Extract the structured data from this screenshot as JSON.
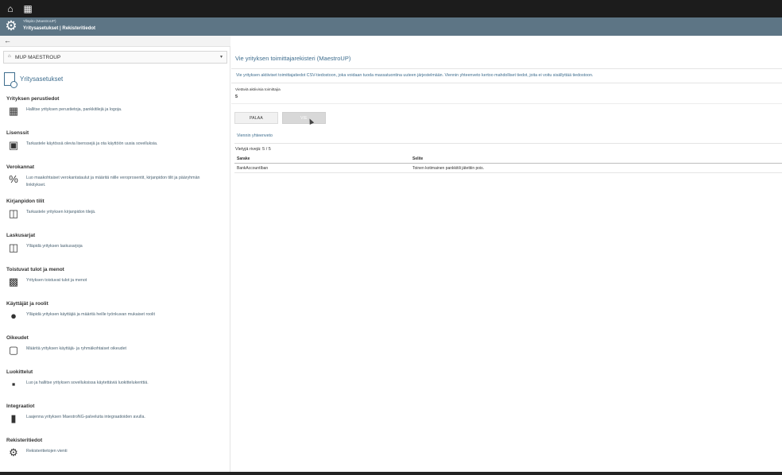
{
  "topbar": {
    "home_icon": "home-icon",
    "apps_icon": "grid-icon"
  },
  "header": {
    "breadcrumb_small": "Ylläpito (MaestroUP)",
    "title": "Yritysasetukset | Rekisteritiedot"
  },
  "sidebar": {
    "company": "MUP MAESTROUP",
    "heading": "Yritysasetukset",
    "items": [
      {
        "title": "Yrityksen perustiedot",
        "desc": "Hallitse yrityksen perustietoja, pankkitilejä ja logoja.",
        "icon": "building-icon"
      },
      {
        "title": "Lisenssit",
        "desc": "Tarkastele käytössä olevia lisenssejä ja ota käyttöön uusia sovelluksia.",
        "icon": "briefcase-icon"
      },
      {
        "title": "Verokannat",
        "desc": "Luo maakohtaiset verokantataulut ja määritä niille veroprosentit, kirjanpidon tilit ja pääryhmän linkitykset.",
        "icon": "percent-icon"
      },
      {
        "title": "Kirjanpidon tilit",
        "desc": "Tarkastele yrityksen kirjanpidon tilejä.",
        "icon": "book-icon"
      },
      {
        "title": "Laskusarjat",
        "desc": "Ylläpidä yrityksen laskusarjoja",
        "icon": "book-icon"
      },
      {
        "title": "Toistuvat tulot ja menot",
        "desc": "Yrityksen toistuvat tulot ja menot",
        "icon": "money-icon"
      },
      {
        "title": "Käyttäjät ja roolit",
        "desc": "Ylläpidä yrityksen käyttäjiä ja määritä heille työnkuvan mukaiset roolit",
        "icon": "user-icon"
      },
      {
        "title": "Oikeudet",
        "desc": "Määritä yrityksen käyttäjä- ja ryhmäkohtaiset oikeudet",
        "icon": "unlock-icon"
      },
      {
        "title": "Luokittelut",
        "desc": "Luo ja hallitse yrityksen sovelluksissa käytettäviä luokittelukenttiä.",
        "icon": "cubes-icon"
      },
      {
        "title": "Integraatiot",
        "desc": "Laajenna yrityksen MaestroNG-palveluita integraatioiden avulla.",
        "icon": "puzzle-icon"
      },
      {
        "title": "Rekisteritiedot",
        "desc": "Rekisteritietojen vienti",
        "icon": "gear-icon"
      }
    ]
  },
  "main": {
    "title": "Vie yrityksen toimittajarekisteri (MaestroUP)",
    "info": "Vie yrityksen aktiiviset toimittajatiedot CSV-tiedostoon, joka voidaan tuoda massatuontina uuteen järjestelmään. Viennin yhteenveto kertoo mahdolliset tiedot, joita ei voitu sisällyttää tiedostoon.",
    "count_label": "Vietäviä aktiivisia toimittajia",
    "count_value": "5",
    "back_label": "PALAA",
    "export_label": "VIE",
    "summary_label": "Viennin yhteenveto",
    "rows_label": "Vietyjä rivejä: 5 / 5",
    "table": {
      "headers": [
        "Sarake",
        "Selite"
      ],
      "rows": [
        [
          "BankAccountIban",
          "Toinen kotimainen pankkitili jätettiin pois."
        ]
      ]
    }
  }
}
